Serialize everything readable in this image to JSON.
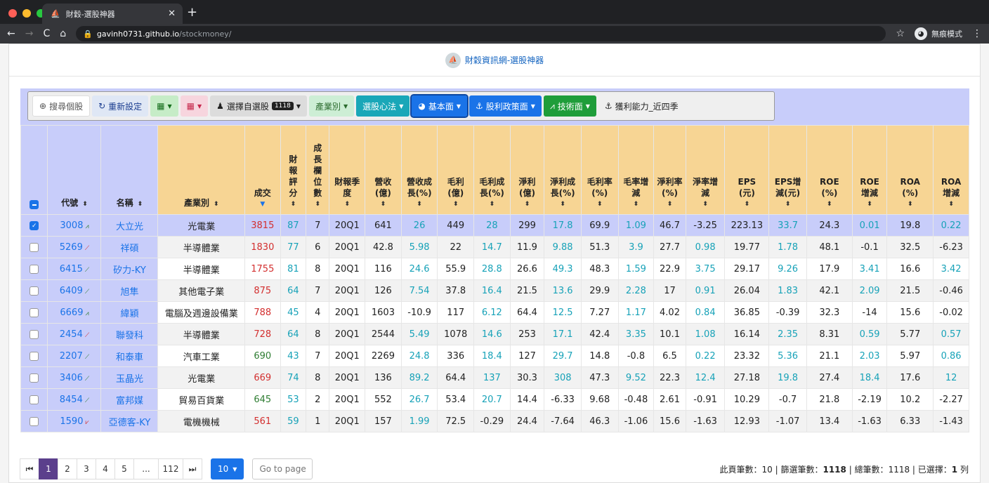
{
  "browser": {
    "tab_title": "財穀-選股神器",
    "tab_close": "✕",
    "new_tab": "+",
    "url_host": "gavinh0731.github.io",
    "url_path": "/stockmoney/",
    "incognito_label": "無痕模式"
  },
  "brand": {
    "title": "財穀資訊網-選股神器"
  },
  "toolbar": {
    "search": "搜尋個股",
    "reset": "重新設定",
    "watchlist": "選擇自選股",
    "watchlist_count": "1118",
    "industry": "產業別",
    "strategy": "選股心法",
    "fundamental": "基本面",
    "dividend": "股利政策面",
    "technical": "技術面",
    "current_filter": "獲利能力_近四季"
  },
  "table": {
    "headers": [
      "代號",
      "名稱",
      "產業別",
      "成交",
      "財報評分",
      "成長欄位數",
      "財報季度",
      "營收(億)",
      "營收成長(%)",
      "毛利(億)",
      "毛利成長(%)",
      "淨利(億)",
      "淨利成長(%)",
      "毛利率(%)",
      "毛率增減",
      "淨利率(%)",
      "淨率增減",
      "EPS(元)",
      "EPS增減(元)",
      "ROE(%)",
      "ROE增減",
      "ROA(%)",
      "ROA增減"
    ],
    "rows": [
      [
        "3008",
        "大立光",
        "光電業",
        "3815",
        "87",
        "7",
        "20Q1",
        "641",
        "26",
        "449",
        "28",
        "299",
        "17.8",
        "69.9",
        "1.09",
        "46.7",
        "-3.25",
        "223.13",
        "33.7",
        "24.3",
        "0.01",
        "19.8",
        "0.22"
      ],
      [
        "5269",
        "祥碩",
        "半導體業",
        "1830",
        "77",
        "6",
        "20Q1",
        "42.8",
        "5.98",
        "22",
        "14.7",
        "11.9",
        "9.88",
        "51.3",
        "3.9",
        "27.7",
        "0.98",
        "19.77",
        "1.78",
        "48.1",
        "-0.1",
        "32.5",
        "-6.23"
      ],
      [
        "6415",
        "矽力-KY",
        "半導體業",
        "1755",
        "81",
        "8",
        "20Q1",
        "116",
        "24.6",
        "55.9",
        "28.8",
        "26.6",
        "49.3",
        "48.3",
        "1.59",
        "22.9",
        "3.75",
        "29.17",
        "9.26",
        "17.9",
        "3.41",
        "16.6",
        "3.42"
      ],
      [
        "6409",
        "旭隼",
        "其他電子業",
        "875",
        "64",
        "7",
        "20Q1",
        "126",
        "7.54",
        "37.8",
        "16.4",
        "21.5",
        "13.6",
        "29.9",
        "2.28",
        "17",
        "0.91",
        "26.04",
        "1.83",
        "42.1",
        "2.09",
        "21.5",
        "-0.46"
      ],
      [
        "6669",
        "緯穎",
        "電腦及週邊設備業",
        "788",
        "45",
        "4",
        "20Q1",
        "1603",
        "-10.9",
        "117",
        "6.12",
        "64.4",
        "12.5",
        "7.27",
        "1.17",
        "4.02",
        "0.84",
        "36.85",
        "-0.39",
        "32.3",
        "-14",
        "15.6",
        "-0.02"
      ],
      [
        "2454",
        "聯發科",
        "半導體業",
        "728",
        "64",
        "8",
        "20Q1",
        "2544",
        "5.49",
        "1078",
        "14.6",
        "253",
        "17.1",
        "42.4",
        "3.35",
        "10.1",
        "1.08",
        "16.14",
        "2.35",
        "8.31",
        "0.59",
        "5.77",
        "0.57"
      ],
      [
        "2207",
        "和泰車",
        "汽車工業",
        "690",
        "43",
        "7",
        "20Q1",
        "2269",
        "24.8",
        "336",
        "18.4",
        "127",
        "29.7",
        "14.8",
        "-0.8",
        "6.5",
        "0.22",
        "23.32",
        "5.36",
        "21.1",
        "2.03",
        "5.97",
        "0.86"
      ],
      [
        "3406",
        "玉晶光",
        "光電業",
        "669",
        "74",
        "8",
        "20Q1",
        "136",
        "89.2",
        "64.4",
        "137",
        "30.3",
        "308",
        "47.3",
        "9.52",
        "22.3",
        "12.4",
        "27.18",
        "19.8",
        "27.4",
        "18.4",
        "17.6",
        "12"
      ],
      [
        "8454",
        "富邦媒",
        "貿易百貨業",
        "645",
        "53",
        "2",
        "20Q1",
        "552",
        "26.7",
        "53.4",
        "20.7",
        "14.4",
        "-6.33",
        "9.68",
        "-0.48",
        "2.61",
        "-0.91",
        "10.29",
        "-0.7",
        "21.8",
        "-2.19",
        "10.2",
        "-2.27"
      ],
      [
        "1590",
        "亞德客-KY",
        "電機機械",
        "561",
        "59",
        "1",
        "20Q1",
        "157",
        "1.99",
        "72.5",
        "-0.29",
        "24.4",
        "-7.64",
        "46.3",
        "-1.06",
        "15.6",
        "-1.63",
        "12.93",
        "-1.07",
        "13.4",
        "-1.63",
        "6.33",
        "-1.43"
      ]
    ],
    "selected_row": 0
  },
  "pager": {
    "first": "⏮",
    "pages": [
      "1",
      "2",
      "3",
      "4",
      "5",
      "...",
      "112"
    ],
    "last": "⏭",
    "page_size": "10",
    "goto_placeholder": "Go to page"
  },
  "stats": {
    "page_count_label": "此頁筆數：",
    "page_count": "10",
    "filtered_label": "篩選筆數：",
    "filtered": "1118",
    "total_label": "總筆數：",
    "total": "1118",
    "selected_label": "已選擇：",
    "selected": "1",
    "selected_unit": "列"
  },
  "colors": {
    "accent": "#1a73e8",
    "header": "#f7d594",
    "lavender": "#c8cdfa",
    "teal": "#17a2b8",
    "red": "#d32f2f",
    "green": "#2e7d32"
  }
}
